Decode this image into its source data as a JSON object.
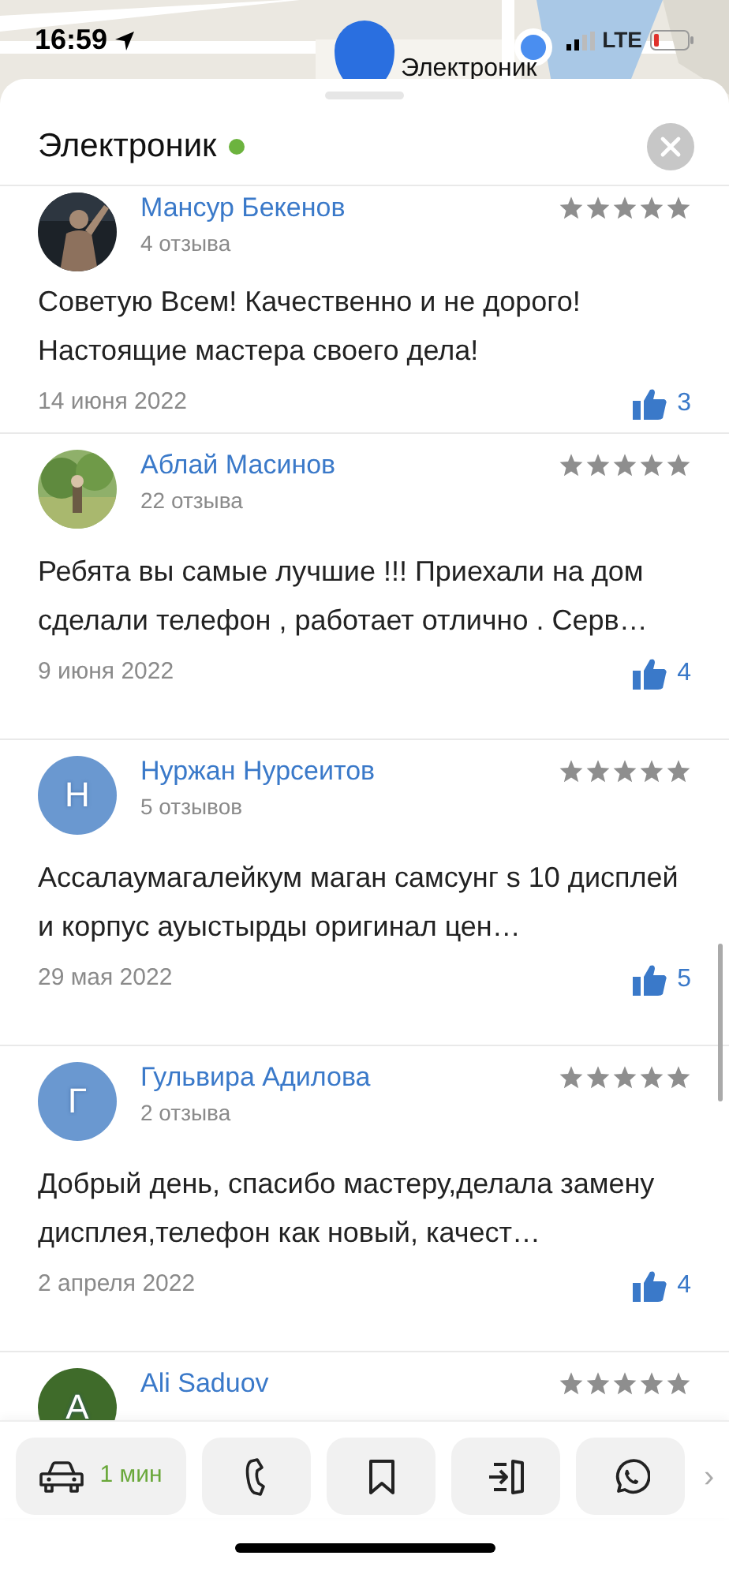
{
  "status_bar": {
    "time": "16:59",
    "network": "LTE"
  },
  "map": {
    "kind": "picture",
    "pin_label": "Электроник"
  },
  "header": {
    "title": "Электроник",
    "open": true
  },
  "reviews": [
    {
      "author": "Мансур Бекенов",
      "count": "4 отзыва",
      "stars": 5,
      "text": "Советую Всем! Качественно и не дорого! Настоящие мастера своего дела!",
      "date": "14 июня 2022",
      "likes": "3"
    },
    {
      "author": "Аблай Масинов",
      "count": "22 отзыва",
      "stars": 5,
      "text": "Ребята вы самые лучшие !!! Приехали на дом сделали телефон , работает отлично . Серв…",
      "date": "9 июня 2022",
      "likes": "4"
    },
    {
      "author": "Нуржан Нурсеитов",
      "count": "5 отзывов",
      "avatar": {
        "kind": "letter",
        "letter": "Н",
        "color": "#6a98d0"
      },
      "stars": 5,
      "text": "Ассалаумагалейкум маган самсунг s 10 дисплей и корпус ауыстырды оригинал цен…",
      "date": "29 мая 2022",
      "likes": "5"
    },
    {
      "author": "Гульвира Адилова",
      "count": "2 отзыва",
      "avatar": {
        "kind": "letter",
        "letter": "Г",
        "color": "#6a98d0"
      },
      "stars": 5,
      "text": "Добрый день, спасибо мастеру,делала замену дисплея,телефон как новый, качест…",
      "date": "2 апреля 2022",
      "likes": "4"
    },
    {
      "author": "Ali Saduov",
      "avatar": {
        "kind": "letter",
        "letter": "A",
        "color": "#3f6b2a"
      },
      "stars": 5
    }
  ],
  "actions": [
    {
      "kind": "car",
      "label": "1 мин"
    },
    {
      "kind": "phone"
    },
    {
      "kind": "bookmark"
    },
    {
      "kind": "entrance"
    },
    {
      "kind": "whatsapp"
    }
  ],
  "more": "›"
}
